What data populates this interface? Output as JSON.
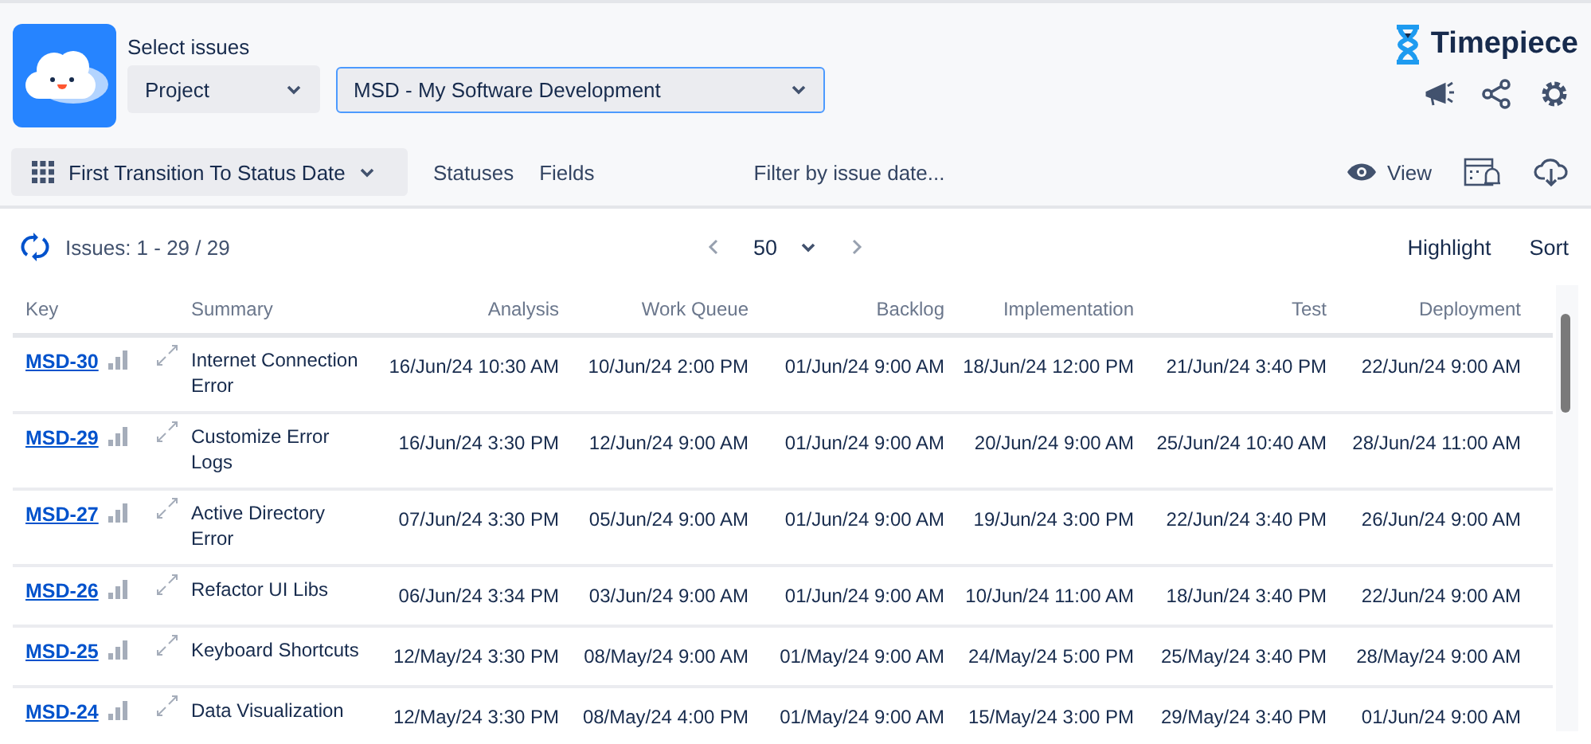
{
  "header": {
    "select_label": "Select issues",
    "scope_dropdown": {
      "value": "Project"
    },
    "project_dropdown": {
      "value": "MSD - My Software Development",
      "focused": true
    },
    "brand": "Timepiece"
  },
  "toolbar": {
    "report_button": "First Transition To Status Date",
    "links": [
      "Statuses",
      "Fields"
    ],
    "filter": "Filter by issue date...",
    "view_button": "View"
  },
  "issues_bar": {
    "count": "Issues: 1 - 29 / 29",
    "page_size": "50",
    "actions": [
      "Highlight",
      "Sort"
    ]
  },
  "table": {
    "columns": [
      "Key",
      "Summary",
      "Analysis",
      "Work Queue",
      "Backlog",
      "Implementation",
      "Test",
      "Deployment"
    ],
    "rows": [
      {
        "cells": [
          "MSD-30",
          "Internet Connection Error",
          "16/Jun/24 10:30 AM",
          "10/Jun/24 2:00 PM",
          "01/Jun/24 9:00 AM",
          "18/Jun/24 12:00 PM",
          "21/Jun/24 3:40 PM",
          "22/Jun/24 9:00 AM"
        ]
      },
      {
        "cells": [
          "MSD-29",
          "Customize Error Logs",
          "16/Jun/24 3:30 PM",
          "12/Jun/24 9:00 AM",
          "01/Jun/24 9:00 AM",
          "20/Jun/24 9:00 AM",
          "25/Jun/24 10:40 AM",
          "28/Jun/24 11:00 AM"
        ]
      },
      {
        "cells": [
          "MSD-27",
          "Active Directory Error",
          "07/Jun/24 3:30 PM",
          "05/Jun/24 9:00 AM",
          "01/Jun/24 9:00 AM",
          "19/Jun/24 3:00 PM",
          "22/Jun/24 3:40 PM",
          "26/Jun/24 9:00 AM"
        ]
      },
      {
        "cells": [
          "MSD-26",
          "Refactor UI Libs",
          "06/Jun/24 3:34 PM",
          "03/Jun/24 9:00 AM",
          "01/Jun/24 9:00 AM",
          "10/Jun/24 11:00 AM",
          "18/Jun/24 3:40 PM",
          "22/Jun/24 9:00 AM"
        ]
      },
      {
        "cells": [
          "MSD-25",
          "Keyboard Shortcuts",
          "12/May/24 3:30 PM",
          "08/May/24 9:00 AM",
          "01/May/24 9:00 AM",
          "24/May/24 5:00 PM",
          "25/May/24 3:40 PM",
          "28/May/24 9:00 AM"
        ]
      },
      {
        "cells": [
          "MSD-24",
          "Data Visualization",
          "12/May/24 3:30 PM",
          "08/May/24 4:00 PM",
          "01/May/24 9:00 AM",
          "15/May/24 3:00 PM",
          "29/May/24 3:40 PM",
          "01/Jun/24 9:00 AM"
        ]
      }
    ]
  }
}
